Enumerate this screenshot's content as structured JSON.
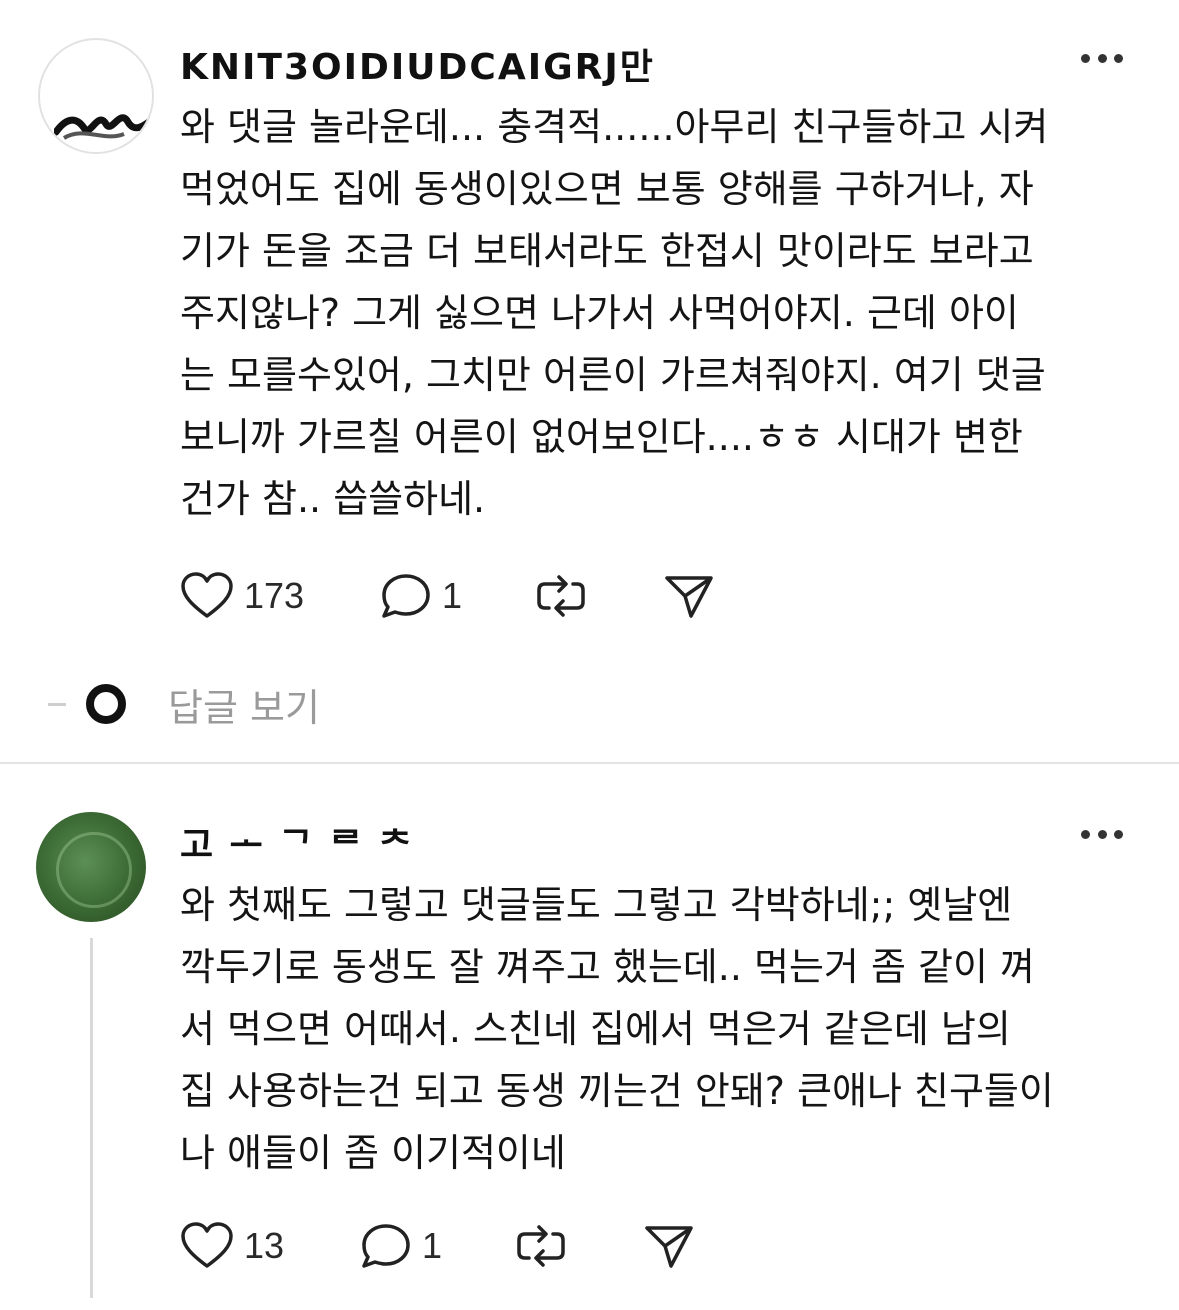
{
  "posts": [
    {
      "username": "KNIT3OIDIUDCAIGRJ만",
      "text": "와 댓글 놀라운데... 충격적......아무리 친구들하고 시켜\n먹었어도 집에 동생이있으면 보통 양해를 구하거나, 자\n기가 돈을 조금 더 보태서라도 한접시 맛이라도 보라고\n주지않나? 그게 싫으면 나가서 사먹어야지. 근데 아이\n는 모를수있어, 그치만 어른이 가르쳐줘야지. 여기 댓글\n보니까 가르칠 어른이 없어보인다....ㅎㅎ 시대가 변한\n건가 참.. 씁쓸하네.",
      "likes": "173",
      "replies": "1",
      "view_replies_label": "답글 보기"
    },
    {
      "username": "고 ᅩ ᄀ ᄅ ᄎ",
      "text": "와 첫째도 그렇고 댓글들도 그렇고 각박하네;; 옛날엔\n깍두기로 동생도 잘 껴주고 했는데.. 먹는거 좀 같이 껴\n서 먹으면 어때서. 스친네 집에서 먹은거 같은데 남의\n집 사용하는건 되고 동생 끼는건 안돼? 큰애나 친구들이\n나 애들이 좀 이기적이네",
      "likes": "13",
      "replies": "1"
    }
  ],
  "icons": {
    "like": "heart-icon",
    "reply": "speech-bubble-icon",
    "repost": "repost-icon",
    "share": "send-icon",
    "more": "more-dots-icon"
  },
  "colors": {
    "text": "#141414",
    "muted": "#9a9a9a",
    "divider": "#e4e4e4",
    "avatar_green": "#3f7038"
  }
}
